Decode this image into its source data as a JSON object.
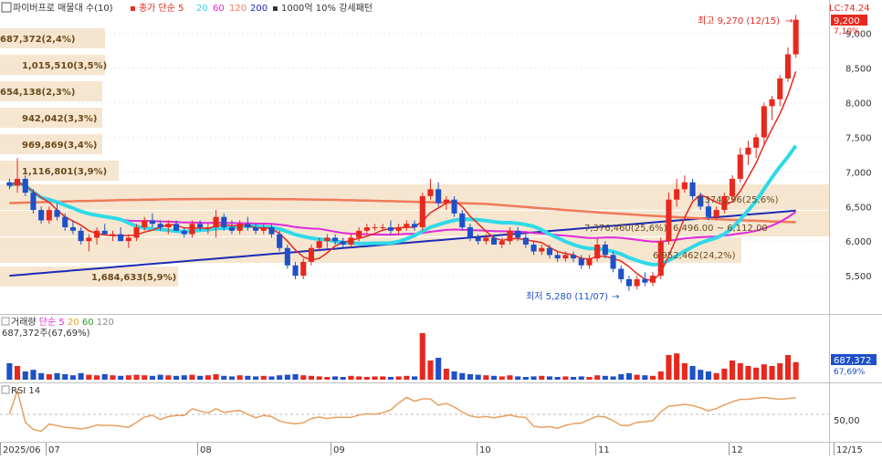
{
  "header": {
    "title": "파이버프로 매물대 수(10)",
    "ma_label": "종가 단순",
    "ma_periods": [
      "5",
      "20",
      "60",
      "120",
      "200"
    ],
    "extra": "1000억 10% 강세패턴",
    "lc_label": "LC:74.24"
  },
  "volume_header": {
    "title": "거래량",
    "ma_label": "단순",
    "ma_periods": [
      "5",
      "20",
      "60",
      "120"
    ],
    "value_label": "687,372주(67,69%)"
  },
  "rsi_header": {
    "title": "RSI 14"
  },
  "annotations": {
    "high_label": "최고 9,270 (12/15)",
    "low_label": "최저 5,280 (11/07)",
    "avg_label": "7,374,296(25,6%)",
    "box_label": "7,376,460(25,6%)",
    "range_label": "6,496.00 ~ 6,112.00",
    "mid_label": "6,952,462(24,2%)"
  },
  "price_badges": {
    "current": "9,200",
    "change": "7,10%"
  },
  "volume_badges": {
    "value": "687,372",
    "pct": "67,69%"
  },
  "colors": {
    "up": "#e8281e",
    "down": "#1e50c8",
    "ma5": "#e8281e",
    "ma20": "#2fd9e8",
    "ma60": "#e02ad8",
    "ma120": "#f07a5a",
    "ma200": "#1e2ab4",
    "profile": "#f5e2c8",
    "profile_text": "#6a4a1a",
    "rsi": "#e8a060"
  },
  "chart_data": {
    "type": "candlestick",
    "price_axis": {
      "min": 5000,
      "max": 9300,
      "ticks": [
        "5,500",
        "6,000",
        "6,500",
        "7,000",
        "7,500",
        "8,000",
        "8,500",
        "9,000"
      ]
    },
    "x_labels": [
      "2025/06",
      "07",
      "08",
      "09",
      "10",
      "11",
      "12",
      "12/15"
    ],
    "volume_profile": [
      {
        "label": "687,372(2,4%)"
      },
      {
        "label": "1,015,510(3,5%)"
      },
      {
        "label": "654,138(2,3%)"
      },
      {
        "label": "942,042(3,3%)"
      },
      {
        "label": "969,869(3,4%)"
      },
      {
        "label": "1,116,801(3,9%)"
      },
      {
        "label": "7,374,296(25,6%)"
      },
      {
        "label": "7,376,460(25,6%)"
      },
      {
        "label": "6,952,462(24,2%)"
      },
      {
        "label": "1,684,633(5,9%)"
      }
    ],
    "rsi_axis": {
      "ticks": [
        "50,00"
      ]
    },
    "candles": [
      [
        6850,
        6900,
        6750,
        6800
      ],
      [
        6800,
        7200,
        6700,
        6900
      ],
      [
        6900,
        6950,
        6650,
        6700
      ],
      [
        6700,
        6750,
        6400,
        6450
      ],
      [
        6450,
        6500,
        6250,
        6300
      ],
      [
        6300,
        6500,
        6250,
        6450
      ],
      [
        6450,
        6550,
        6300,
        6350
      ],
      [
        6350,
        6400,
        6150,
        6200
      ],
      [
        6200,
        6300,
        6100,
        6150
      ],
      [
        6150,
        6200,
        5950,
        6000
      ],
      [
        6000,
        6100,
        5850,
        6050
      ],
      [
        6050,
        6200,
        5950,
        6150
      ],
      [
        6150,
        6250,
        6100,
        6100
      ],
      [
        6100,
        6150,
        6000,
        6100
      ],
      [
        6100,
        6200,
        6000,
        6000
      ],
      [
        6000,
        6100,
        5900,
        6050
      ],
      [
        6050,
        6250,
        6000,
        6200
      ],
      [
        6200,
        6350,
        6150,
        6300
      ],
      [
        6300,
        6400,
        6200,
        6250
      ],
      [
        6250,
        6300,
        6150,
        6200
      ],
      [
        6200,
        6300,
        6100,
        6250
      ],
      [
        6250,
        6300,
        6150,
        6150
      ],
      [
        6150,
        6200,
        6050,
        6100
      ],
      [
        6100,
        6300,
        6050,
        6250
      ],
      [
        6250,
        6300,
        6150,
        6200
      ],
      [
        6200,
        6250,
        6100,
        6200
      ],
      [
        6200,
        6450,
        6050,
        6350
      ],
      [
        6350,
        6400,
        6150,
        6200
      ],
      [
        6200,
        6300,
        6100,
        6150
      ],
      [
        6150,
        6300,
        6100,
        6250
      ],
      [
        6250,
        6350,
        6150,
        6200
      ],
      [
        6200,
        6250,
        6100,
        6150
      ],
      [
        6150,
        6250,
        6100,
        6200
      ],
      [
        6200,
        6250,
        6050,
        6100
      ],
      [
        6100,
        6150,
        5850,
        5900
      ],
      [
        5900,
        5950,
        5600,
        5650
      ],
      [
        5650,
        5700,
        5450,
        5500
      ],
      [
        5500,
        5750,
        5450,
        5700
      ],
      [
        5700,
        5950,
        5650,
        5900
      ],
      [
        5900,
        6050,
        5850,
        6000
      ],
      [
        6000,
        6100,
        5900,
        6050
      ],
      [
        6050,
        6100,
        5950,
        6000
      ],
      [
        6000,
        6050,
        5900,
        5950
      ],
      [
        5950,
        6100,
        5900,
        6050
      ],
      [
        6050,
        6200,
        6000,
        6150
      ],
      [
        6150,
        6250,
        6100,
        6200
      ],
      [
        6200,
        6250,
        6150,
        6200
      ],
      [
        6200,
        6250,
        6150,
        6200
      ],
      [
        6200,
        6300,
        6100,
        6150
      ],
      [
        6150,
        6250,
        6100,
        6200
      ],
      [
        6200,
        6300,
        6150,
        6250
      ],
      [
        6250,
        6300,
        6150,
        6200
      ],
      [
        6200,
        6700,
        6150,
        6650
      ],
      [
        6650,
        6900,
        6600,
        6750
      ],
      [
        6750,
        6850,
        6500,
        6550
      ],
      [
        6550,
        6650,
        6450,
        6600
      ],
      [
        6600,
        6650,
        6350,
        6400
      ],
      [
        6400,
        6450,
        6150,
        6200
      ],
      [
        6200,
        6250,
        6000,
        6050
      ],
      [
        6050,
        6100,
        5950,
        6000
      ],
      [
        6000,
        6100,
        5950,
        6050
      ],
      [
        6050,
        6100,
        5950,
        5950
      ],
      [
        5950,
        6050,
        5900,
        6000
      ],
      [
        6000,
        6200,
        5950,
        6150
      ],
      [
        6150,
        6200,
        6000,
        6050
      ],
      [
        6050,
        6100,
        5900,
        5950
      ],
      [
        5950,
        6000,
        5800,
        5850
      ],
      [
        5850,
        5950,
        5800,
        5900
      ],
      [
        5900,
        5950,
        5750,
        5800
      ],
      [
        5800,
        5850,
        5700,
        5750
      ],
      [
        5750,
        5850,
        5700,
        5800
      ],
      [
        5800,
        5850,
        5700,
        5750
      ],
      [
        5750,
        5800,
        5600,
        5650
      ],
      [
        5650,
        5800,
        5600,
        5750
      ],
      [
        5750,
        6050,
        5700,
        5950
      ],
      [
        5950,
        6000,
        5750,
        5800
      ],
      [
        5800,
        5850,
        5550,
        5600
      ],
      [
        5600,
        5650,
        5400,
        5450
      ],
      [
        5450,
        5500,
        5280,
        5350
      ],
      [
        5350,
        5500,
        5300,
        5450
      ],
      [
        5450,
        5550,
        5350,
        5400
      ],
      [
        5400,
        5550,
        5350,
        5500
      ],
      [
        5500,
        6050,
        5450,
        6000
      ],
      [
        6000,
        6700,
        5950,
        6600
      ],
      [
        6600,
        6900,
        6500,
        6750
      ],
      [
        6750,
        6950,
        6700,
        6850
      ],
      [
        6850,
        6900,
        6600,
        6650
      ],
      [
        6650,
        6700,
        6450,
        6500
      ],
      [
        6500,
        6600,
        6300,
        6350
      ],
      [
        6350,
        6500,
        6300,
        6450
      ],
      [
        6450,
        6700,
        6400,
        6650
      ],
      [
        6650,
        6950,
        6600,
        6900
      ],
      [
        6900,
        7350,
        6850,
        7250
      ],
      [
        7250,
        7450,
        7100,
        7350
      ],
      [
        7350,
        7550,
        7200,
        7500
      ],
      [
        7500,
        8000,
        7400,
        7950
      ],
      [
        7950,
        8100,
        7750,
        8050
      ],
      [
        8050,
        8400,
        7950,
        8350
      ],
      [
        8350,
        8800,
        8300,
        8700
      ],
      [
        8700,
        9270,
        8650,
        9200
      ]
    ],
    "volumes": [
      0.3,
      0.25,
      0.15,
      0.18,
      0.12,
      0.1,
      0.12,
      0.1,
      0.08,
      0.12,
      0.09,
      0.08,
      0.1,
      0.08,
      0.07,
      0.08,
      0.09,
      0.08,
      0.07,
      0.09,
      0.08,
      0.07,
      0.08,
      0.09,
      0.07,
      0.08,
      0.1,
      0.07,
      0.06,
      0.08,
      0.07,
      0.06,
      0.07,
      0.06,
      0.08,
      0.09,
      0.1,
      0.08,
      0.07,
      0.06,
      0.05,
      0.06,
      0.05,
      0.07,
      0.06,
      0.05,
      0.06,
      0.06,
      0.05,
      0.06,
      0.07,
      0.06,
      0.85,
      0.35,
      0.4,
      0.2,
      0.15,
      0.12,
      0.1,
      0.09,
      0.08,
      0.07,
      0.06,
      0.08,
      0.06,
      0.05,
      0.06,
      0.07,
      0.06,
      0.05,
      0.06,
      0.05,
      0.06,
      0.05,
      0.08,
      0.07,
      0.06,
      0.1,
      0.12,
      0.09,
      0.08,
      0.07,
      0.15,
      0.45,
      0.48,
      0.3,
      0.25,
      0.18,
      0.15,
      0.12,
      0.2,
      0.35,
      0.3,
      0.25,
      0.22,
      0.28,
      0.25,
      0.3,
      0.45,
      0.32
    ]
  }
}
